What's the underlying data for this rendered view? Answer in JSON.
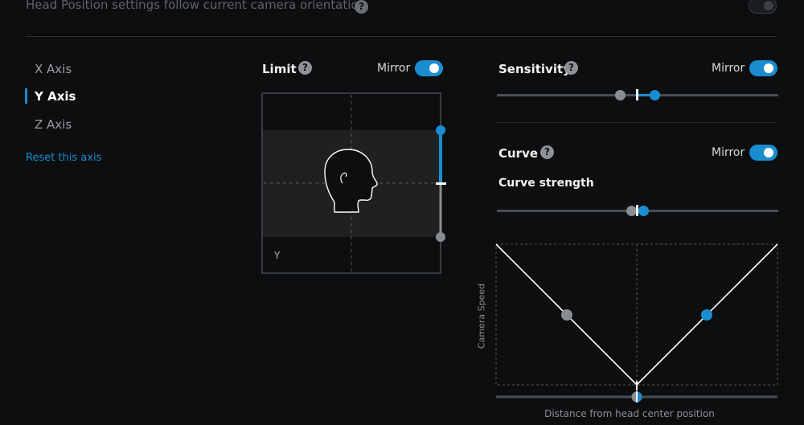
{
  "header": {
    "follow_camera_label": "Head Position settings follow current camera orientation"
  },
  "axes": {
    "items": [
      {
        "label": "X Axis",
        "active": false
      },
      {
        "label": "Y Axis",
        "active": true
      },
      {
        "label": "Z Axis",
        "active": false
      }
    ],
    "reset_label": "Reset this axis"
  },
  "limit": {
    "title": "Limit",
    "help": "?",
    "mirror_label": "Mirror",
    "mirror_on": true,
    "preview_axis_label": "Y"
  },
  "sensitivity": {
    "title": "Sensitivity",
    "help": "?",
    "mirror_label": "Mirror",
    "mirror_on": true
  },
  "curve": {
    "title": "Curve",
    "help": "?",
    "mirror_label": "Mirror",
    "mirror_on": true,
    "strength_label": "Curve strength",
    "y_axis_label": "Camera Speed",
    "x_axis_label": "Distance from head center position"
  },
  "colors": {
    "accent": "#1a8dd0",
    "grey_handle": "#8a8d90",
    "background": "#0d0e10"
  }
}
